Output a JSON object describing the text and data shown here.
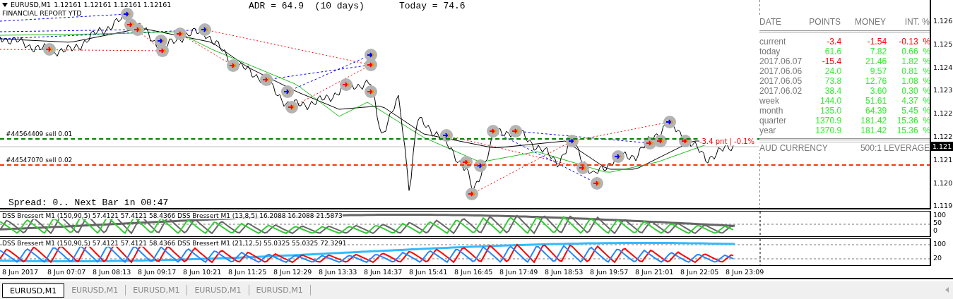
{
  "chart": {
    "symbol": "EURUSD,M1",
    "quote": "1.12161 1.12161 1.12161 1.12161",
    "report_title": "FINANCIAL REPORT YTD",
    "adr": "ADR = 64.9  (10 days)",
    "today": "Today = 74.6",
    "spread": "Spread: 0.. Next Bar in 00:47",
    "pnl_label": "-3.4 pnt | -0.1%",
    "orders": [
      {
        "label": "#44564409 sell 0.01",
        "kind": "open"
      },
      {
        "label": "#44547070 sell 0.02",
        "kind": "target"
      }
    ]
  },
  "report": {
    "columns": [
      "DATE",
      "POINTS",
      "MONEY",
      "INT. %"
    ],
    "rows": [
      {
        "cells": [
          {
            "text": "current"
          },
          {
            "text": "-3.4",
            "color": "#ff0000"
          },
          {
            "text": "-1.54",
            "color": "#ff0000"
          },
          {
            "text": "-0.13  %",
            "color": "#ff0000"
          }
        ]
      },
      {
        "cells": [
          {
            "text": "today"
          },
          {
            "text": "61.6",
            "color": "#33ee33"
          },
          {
            "text": "7.82",
            "color": "#33ee33"
          },
          {
            "text": "0.66  %",
            "color": "#33ee33"
          }
        ]
      },
      {
        "cells": [
          {
            "text": "2017.06.07"
          },
          {
            "text": "-15.4",
            "color": "#ff0000"
          },
          {
            "text": "21.46",
            "color": "#33ee33"
          },
          {
            "text": "1.82  %",
            "color": "#33ee33"
          }
        ]
      },
      {
        "cells": [
          {
            "text": "2017.06.06"
          },
          {
            "text": "24.0",
            "color": "#33ee33"
          },
          {
            "text": "9.57",
            "color": "#33ee33"
          },
          {
            "text": "0.81  %",
            "color": "#33ee33"
          }
        ]
      },
      {
        "cells": [
          {
            "text": "2017.06.05"
          },
          {
            "text": "73.8",
            "color": "#33ee33"
          },
          {
            "text": "12.76",
            "color": "#33ee33"
          },
          {
            "text": "1.08  %",
            "color": "#33ee33"
          }
        ]
      },
      {
        "cells": [
          {
            "text": "2017.06.02"
          },
          {
            "text": "38.4",
            "color": "#33ee33"
          },
          {
            "text": "3.60",
            "color": "#33ee33"
          },
          {
            "text": "0.30  %",
            "color": "#33ee33"
          }
        ]
      },
      {
        "cells": [
          {
            "text": "week"
          },
          {
            "text": "144.0",
            "color": "#33ee33"
          },
          {
            "text": "51.61",
            "color": "#33ee33"
          },
          {
            "text": "4.37  %",
            "color": "#33ee33"
          }
        ]
      },
      {
        "cells": [
          {
            "text": "month"
          },
          {
            "text": "135.0",
            "color": "#33ee33"
          },
          {
            "text": "64.39",
            "color": "#33ee33"
          },
          {
            "text": "5.45  %",
            "color": "#33ee33"
          }
        ]
      },
      {
        "cells": [
          {
            "text": "quarter"
          },
          {
            "text": "1370.9",
            "color": "#33ee33"
          },
          {
            "text": "181.42",
            "color": "#33ee33"
          },
          {
            "text": "15.36  %",
            "color": "#33ee33"
          }
        ]
      },
      {
        "cells": [
          {
            "text": "year"
          },
          {
            "text": "1370.9",
            "color": "#33ee33"
          },
          {
            "text": "181.42",
            "color": "#33ee33"
          },
          {
            "text": "15.36  %",
            "color": "#33ee33"
          }
        ]
      }
    ],
    "currency": "AUD CURRENCY",
    "leverage": "500:1 LEVERAGE"
  },
  "price_axis": {
    "ticks": [
      "1.126",
      "1.125",
      "1.124",
      "1.123",
      "1.122",
      "1.122",
      "1.121",
      "1.120",
      "1.119"
    ],
    "current": "1.121"
  },
  "indicators": [
    {
      "label": "DSS Bressert M1 (150,90,5) 57.4121 57.4121 58.4366  DSS Bressert M1 (13,8,5) 16.2088 16.2088 21.5873",
      "scale": [
        "100",
        "50",
        "0"
      ]
    },
    {
      "label": "DSS Bressert M1 (150,90,5) 57.4121 57.4121 58.4366  DSS Bressert M1 (21,12,5) 55.0325 55.0325 72.3291",
      "scale": [
        "100",
        "20"
      ]
    }
  ],
  "time_axis": [
    "8 Jun 2017",
    "8 Jun 07:07",
    "8 Jun 08:13",
    "8 Jun 09:17",
    "8 Jun 10:21",
    "8 Jun 11:25",
    "8 Jun 12:29",
    "8 Jun 13:33",
    "8 Jun 14:37",
    "8 Jun 15:41",
    "8 Jun 16:45",
    "8 Jun 17:49",
    "8 Jun 18:53",
    "8 Jun 19:57",
    "8 Jun 21:01",
    "8 Jun 22:05",
    "8 Jun 23:09"
  ],
  "tabs": [
    {
      "label": "EURUSD,M1",
      "selected": true
    },
    {
      "label": "EURUSD,M1",
      "selected": false
    },
    {
      "label": "EURUSD,M1",
      "selected": false
    },
    {
      "label": "EURUSD,M1",
      "selected": false
    },
    {
      "label": "EURUSD,M1",
      "selected": false
    }
  ]
}
